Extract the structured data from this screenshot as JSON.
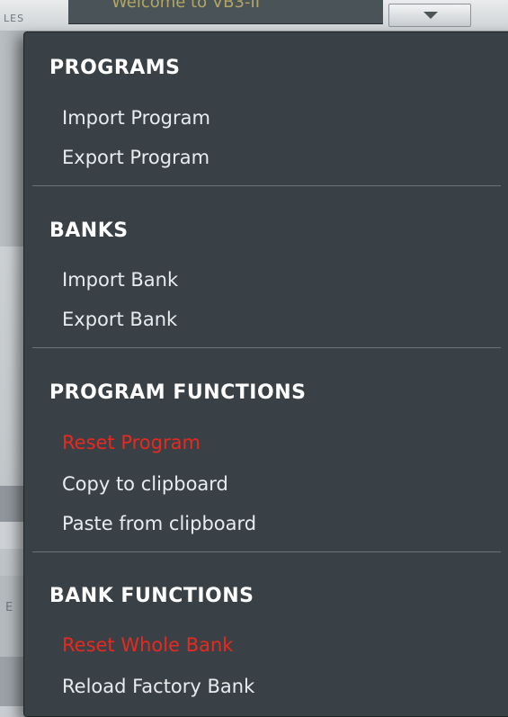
{
  "background": {
    "top_tab_label": "LES",
    "top_field_text": "Welcome to VB3-II",
    "left_letter": "E"
  },
  "menu": {
    "sections": [
      {
        "header": "PROGRAMS",
        "items": [
          {
            "label": "Import Program",
            "danger": false
          },
          {
            "label": "Export Program",
            "danger": false
          }
        ]
      },
      {
        "header": "BANKS",
        "items": [
          {
            "label": "Import Bank",
            "danger": false
          },
          {
            "label": "Export Bank",
            "danger": false
          }
        ]
      },
      {
        "header": "PROGRAM FUNCTIONS",
        "items": [
          {
            "label": "Reset Program",
            "danger": true
          },
          {
            "label": "Copy to clipboard",
            "danger": false
          },
          {
            "label": "Paste from clipboard",
            "danger": false
          }
        ]
      },
      {
        "header": "BANK FUNCTIONS",
        "items": [
          {
            "label": "Reset Whole Bank",
            "danger": true
          },
          {
            "label": "Reload Factory Bank",
            "danger": false
          }
        ]
      }
    ]
  },
  "colors": {
    "menu_bg": "#394146",
    "text": "#e9ecee",
    "danger": "#e8291f",
    "header": "#ffffff"
  }
}
